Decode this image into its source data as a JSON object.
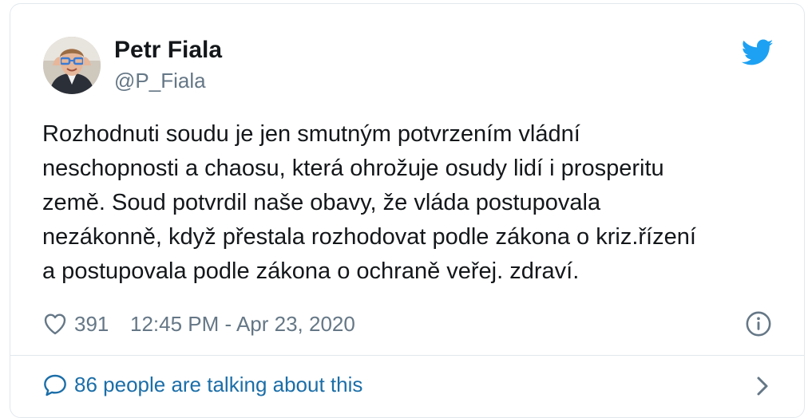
{
  "tweet": {
    "author_name": "Petr Fiala",
    "author_handle": "@P_Fiala",
    "text_lines": [
      "Rozhodnuti soudu je jen smutným potvrzením vládní",
      "neschopnosti a chaosu, která ohrožuje osudy lidí i prosperitu",
      "země. Soud potvrdil naše obavy, že vláda postupovala",
      "nezákonně, když přestala rozhodovat podle zákona o kriz.řízení",
      "a postupovala podle zákona o ochraně veřej. zdraví."
    ],
    "likes": "391",
    "timestamp": "12:45 PM - Apr 23, 2020",
    "talking": "86 people are talking about this"
  },
  "icons": {
    "brand": "twitter-bird-icon",
    "like": "heart-icon",
    "info": "info-icon",
    "reply": "speech-bubble-icon",
    "more": "chevron-right-icon"
  },
  "colors": {
    "twitter_blue": "#1da1f2",
    "link_blue": "#1b6ea8",
    "text": "#14171a",
    "muted": "#657786",
    "border": "#e1e8ed"
  }
}
